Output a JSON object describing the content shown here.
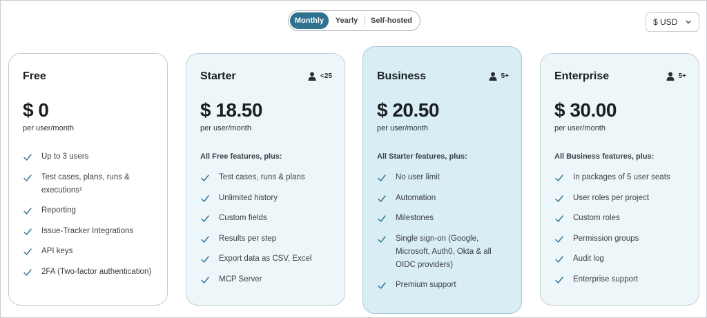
{
  "billing_toggle": {
    "options": [
      "Monthly",
      "Yearly",
      "Self-hosted"
    ],
    "selected": "Monthly"
  },
  "currency": {
    "value": "$ USD",
    "icon": "chevron-down-icon"
  },
  "colors": {
    "accent": "#2f7290",
    "check": "#2f6f94"
  },
  "plans": [
    {
      "name": "Free",
      "seats": "",
      "price": "$ 0",
      "period": "per user/month",
      "intro": "",
      "features": [
        "Up to 3 users",
        "Test cases, plans, runs & executions¹",
        "Reporting",
        "Issue-Tracker Integrations",
        "API keys",
        "2FA (Two-factor authentication)"
      ]
    },
    {
      "name": "Starter",
      "seats": "<25",
      "price": "$ 18.50",
      "period": "per user/month",
      "intro": "All Free features, plus:",
      "features": [
        "Test cases, runs & plans",
        "Unlimited history",
        "Custom fields",
        "Results per step",
        "Export data as CSV, Excel",
        "MCP Server"
      ]
    },
    {
      "name": "Business",
      "seats": "5+",
      "price": "$ 20.50",
      "period": "per user/month",
      "intro": "All Starter features, plus:",
      "features": [
        "No user limit",
        "Automation",
        "Milestones",
        "Single sign-on (Google, Microsoft, Auth0, Okta & all OIDC providers)",
        "Premium support"
      ]
    },
    {
      "name": "Enterprise",
      "seats": "5+",
      "price": "$ 30.00",
      "period": "per user/month",
      "intro": "All Business features, plus:",
      "features": [
        "In packages of 5 user seats",
        "User roles per project",
        "Custom roles",
        "Permission groups",
        "Audit log",
        "Enterprise support"
      ]
    }
  ]
}
